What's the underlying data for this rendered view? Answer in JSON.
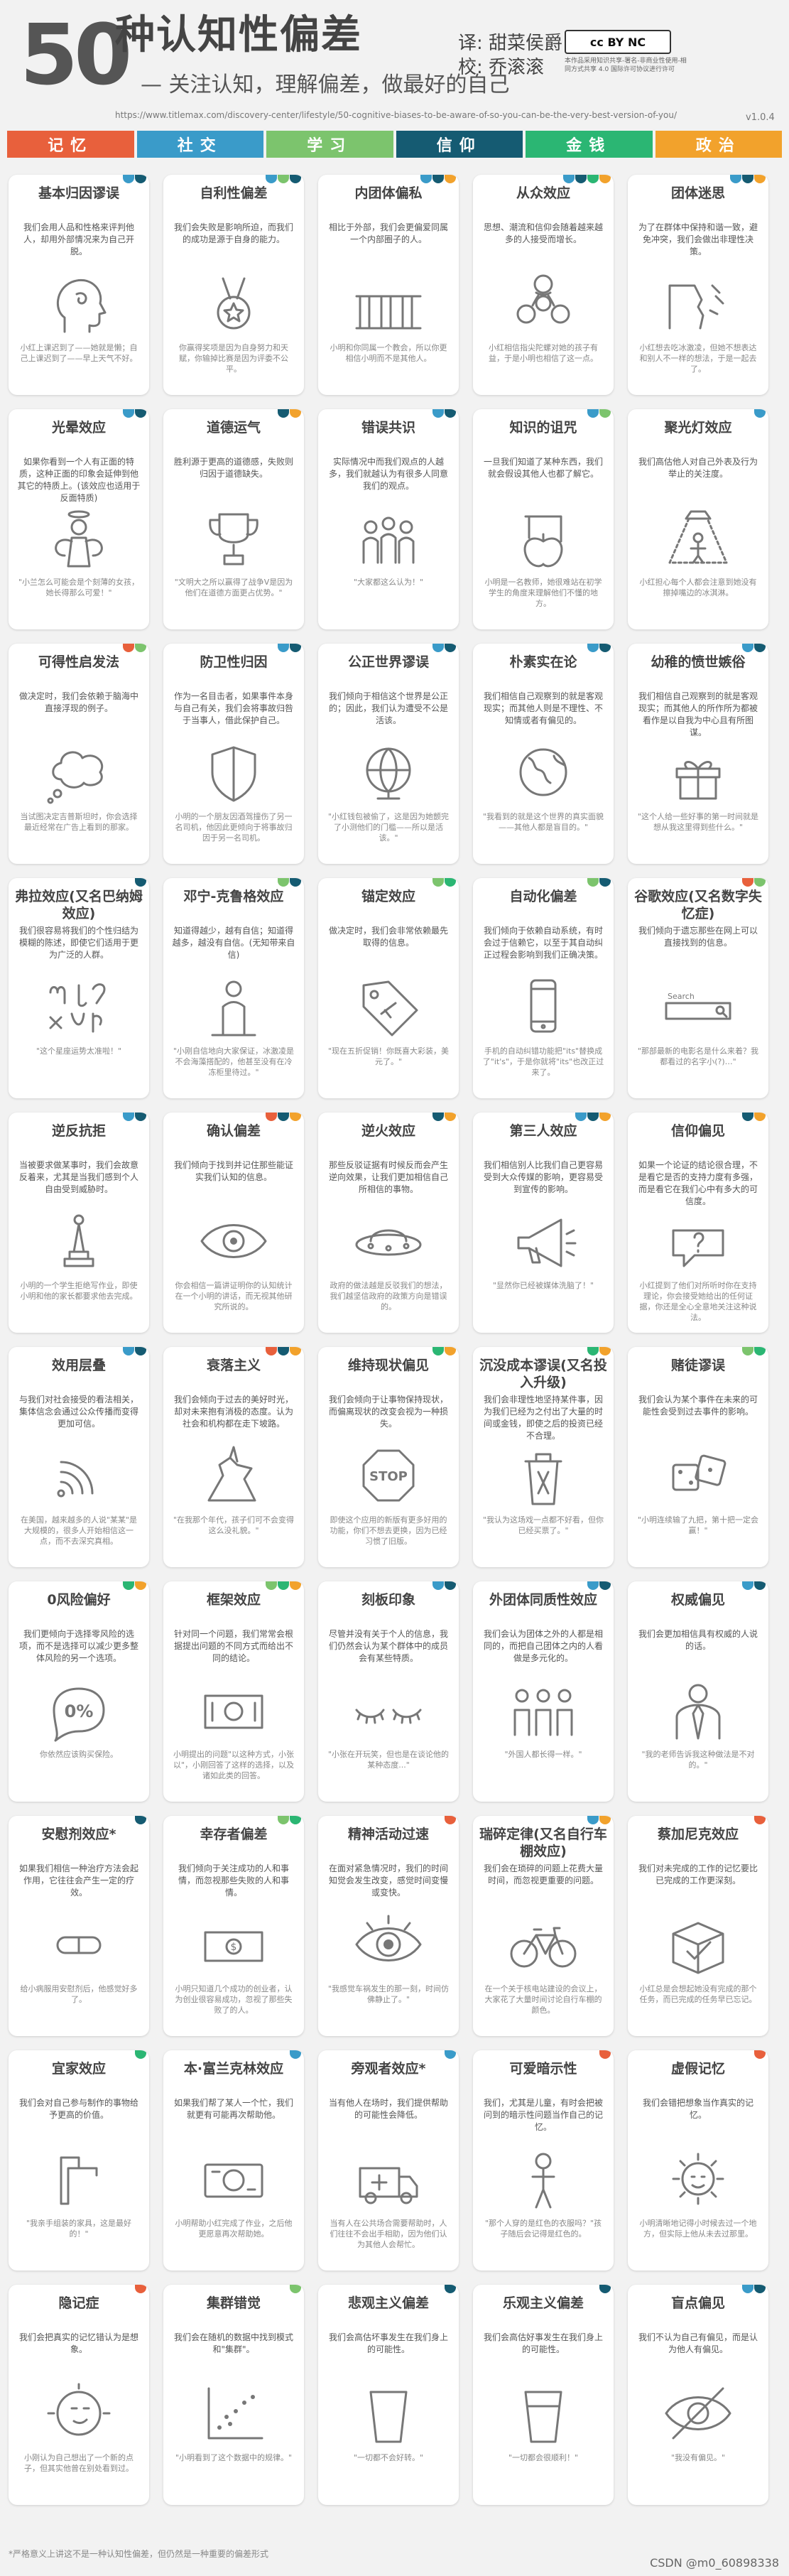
{
  "header": {
    "num": "50",
    "title": "种认知性偏差",
    "subtitle": "— 关注认知，理解偏差，做最好的自己",
    "url": "https://www.titlemax.com/discovery-center/lifestyle/50-cognitive-biases-to-be-aware-of-so-you-can-be-the-very-best-version-of-you/",
    "translator": "译: 甜菜侯爵",
    "proofreader": "校: 乔滚滚",
    "cc_logo": "cc BY NC",
    "cc_text": "本作品采用知识共享-署名-非商业性使用-相同方式共享 4.0 国际许可协议进行许可",
    "version": "v1.0.4"
  },
  "colors": {
    "memory": "#e8603c",
    "social": "#3a9bc9",
    "learning": "#7cc46d",
    "belief": "#155b72",
    "money": "#2bb673",
    "politics": "#f2a22c"
  },
  "categories": [
    {
      "label": "记忆",
      "key": "memory"
    },
    {
      "label": "社交",
      "key": "social"
    },
    {
      "label": "学习",
      "key": "learning"
    },
    {
      "label": "信仰",
      "key": "belief"
    },
    {
      "label": "金钱",
      "key": "money"
    },
    {
      "label": "政治",
      "key": "politics"
    }
  ],
  "cards": [
    {
      "title": "基本归因谬误",
      "desc": "我们会用人品和性格来评判他人，却用外部情况来为自己开脱。",
      "ex": "小红上课迟到了——她就是懒；自己上课迟到了——早上天气不好。",
      "icon": "head-icon",
      "dots": [
        "social",
        "belief"
      ]
    },
    {
      "title": "自利性偏差",
      "desc": "我们会失败是影响所迫，而我们的成功是源于自身的能力。",
      "ex": "你赢得奖项是因为自身努力和天赋，你输掉比赛是因为评委不公平。",
      "icon": "medal-icon",
      "dots": [
        "social",
        "learning",
        "belief"
      ]
    },
    {
      "title": "内团体偏私",
      "desc": "相比于外部，我们会更偏爱同属一个内部圈子的人。",
      "ex": "小明和你同属一个教会，所以你更相信小明而不是其他人。",
      "icon": "stonehenge-icon",
      "dots": [
        "social",
        "belief",
        "politics"
      ]
    },
    {
      "title": "从众效应",
      "desc": "思想、潮流和信仰会随着越来越多的人接受而增长。",
      "ex": "小红相信指尖陀螺对她的孩子有益，于是小明也相信了这一点。",
      "icon": "spinner-icon",
      "dots": [
        "social",
        "belief",
        "money",
        "politics"
      ]
    },
    {
      "title": "团体迷思",
      "desc": "为了在群体中保持和谐一致，避免冲突，我们会做出非理性决策。",
      "ex": "小红想去吃冰激凌，但她不想表达和别人不一样的想法，于是一起去了。",
      "icon": "cliff-icon",
      "dots": [
        "social",
        "belief",
        "politics"
      ]
    },
    {
      "title": "光晕效应",
      "desc": "如果你看到一个人有正面的特质，这种正面的印象会延伸到他其它的特质上。(该效应也适用于反面特质)",
      "ex": "\"小兰怎么可能会是个刻薄的女孩，她长得那么可爱！\"",
      "icon": "angel-icon",
      "dots": [
        "social",
        "belief"
      ]
    },
    {
      "title": "道德运气",
      "desc": "胜利源于更高的道德感，失败则归因于道德缺失。",
      "ex": "\"文明大之所以赢得了战争V是因为他们在道德方面更占优势。\"",
      "icon": "trophy-icon",
      "dots": [
        "belief",
        "politics"
      ]
    },
    {
      "title": "错误共识",
      "desc": "实际情况中而我们观点的人越多，我们就越认为有很多人同意我们的观点。",
      "ex": "\"大家都这么认为！\"",
      "icon": "crowd-icon",
      "dots": [
        "social",
        "belief"
      ]
    },
    {
      "title": "知识的诅咒",
      "desc": "一旦我们知道了某种东西，我们就会假设其他人也都了解它。",
      "ex": "小明是一名教师，她很难站在初学学生的角度来理解他们不懂的地方。",
      "icon": "apple-icon",
      "dots": [
        "social",
        "learning"
      ]
    },
    {
      "title": "聚光灯效应",
      "desc": "我们高估他人对自己外表及行为举止的关注度。",
      "ex": "小红担心每个人都会注意到她没有擦掉嘴边的冰淇淋。",
      "icon": "spotlight-icon",
      "dots": [
        "social"
      ]
    },
    {
      "title": "可得性启发法",
      "desc": "做决定时，我们会依赖于脑海中直接浮现的例子。",
      "ex": "当试图决定吉普斯坦时，你会选择最近经常在广告上看到的那家。",
      "icon": "thought-icon",
      "dots": [
        "memory",
        "learning"
      ]
    },
    {
      "title": "防卫性归因",
      "desc": "作为一名目击者，如果事件本身与自己有关，我们会将事故归咎于当事人，借此保护自己。",
      "ex": "小明的一个朋友因酒驾撞伤了另一名司机，他因此更倾向于将事故归因于另一名司机。",
      "icon": "shield-icon",
      "dots": [
        "social",
        "belief"
      ]
    },
    {
      "title": "公正世界谬误",
      "desc": "我们倾向于相信这个世界是公正的；因此，我们认为遭受不公是活该。",
      "ex": "\"小红钱包被偷了，这是因为她颤完了小测他们的门槛——所以是活该。\"",
      "icon": "globe-icon",
      "dots": [
        "social",
        "belief"
      ]
    },
    {
      "title": "朴素实在论",
      "desc": "我们相信自己观察到的就是客观现实；而其他人则是不理性、不知情或者有偏见的。",
      "ex": "\"我看到的就是这个世界的真实面貌——其他人都是盲目的。\"",
      "icon": "earth-icon",
      "dots": [
        "social",
        "belief"
      ]
    },
    {
      "title": "幼稚的愤世嫉俗",
      "desc": "我们相信自己观察到的就是客观现实；而其他人的所作所为都被看作是以自我为中心且有所图谋。",
      "ex": "\"这个人给一些好事的第一时间就是想从我这里得到些什么。\"",
      "icon": "gift-icon",
      "dots": [
        "social",
        "belief"
      ]
    },
    {
      "title": "弗拉效应(又名巴纳姆效应)",
      "desc": "我们很容易将我们的个性归结为模糊的陈述，即使它们适用于更为广泛的人群。",
      "ex": "\"这个星座运势太准啦！\"",
      "icon": "zodiac-icon",
      "dots": [
        "belief"
      ]
    },
    {
      "title": "邓宁-克鲁格效应",
      "desc": "知道得越少，越有自信；知道得越多，越没有自信。(无知带来自信)",
      "ex": "\"小刚自信地向大家保证，冰激凌是不会海藻搭配的，他甚至没有在冷冻柜里待过。\"",
      "icon": "person-icon",
      "dots": [
        "learning",
        "belief"
      ]
    },
    {
      "title": "锚定效应",
      "desc": "做决定时，我们会非常依赖最先取得的信息。",
      "ex": "\"现在五折促销！你既喜大彩装，美元了。\"",
      "icon": "tag-icon",
      "dots": [
        "learning",
        "money"
      ]
    },
    {
      "title": "自动化偏差",
      "desc": "我们倾向于依赖自动系统，有时会过于信赖它，以至于其自动纠正过程会影响到我们正确决策。",
      "ex": "手机的自动纠错功能把\"its\"替换成了\"it's\"，于是你就将\"its\"也改正过来了。",
      "icon": "phone-icon",
      "dots": [
        "learning",
        "belief"
      ]
    },
    {
      "title": "谷歌效应(又名数字失忆症)",
      "desc": "我们倾向于遗忘那些在网上可以直接找到的信息。",
      "ex": "\"那部最新的电影名是什么来着？我都看过的名字小(?)…\"",
      "icon": "search-box-icon",
      "dots": [
        "memory",
        "learning"
      ],
      "search_label": "Search"
    },
    {
      "title": "逆反抗拒",
      "desc": "当被要求做某事时，我们会故意反着来，尤其是当我们感到个人自由受到威胁时。",
      "ex": "小明的一个学生拒绝写作业，即使小明和他的家长都要求他去完成。",
      "icon": "pawn-icon",
      "dots": [
        "social",
        "belief"
      ]
    },
    {
      "title": "确认偏差",
      "desc": "我们倾向于找到并记住那些能证实我们认知的信息。",
      "ex": "你会相信一篇讲证明你的认知统计在一个小明的讲话，而无视其他研究所说的。",
      "icon": "eye-icon",
      "dots": [
        "memory",
        "belief",
        "politics"
      ]
    },
    {
      "title": "逆火效应",
      "desc": "那些反驳证据有时候反而会产生逆向效果，让我们更加相信自己所相信的事物。",
      "ex": "政府的做法越是反驳我们的想法，我们越坚信政府的政策方向是错误的。",
      "icon": "ufo-icon",
      "dots": [
        "belief",
        "politics"
      ]
    },
    {
      "title": "第三人效应",
      "desc": "我们相信别人比我们自己更容易受到大众传媒的影响，更容易受到宣传的影响。",
      "ex": "\"显然你已经被媒体洗脑了！\"",
      "icon": "megaphone-icon",
      "dots": [
        "social",
        "belief",
        "politics"
      ]
    },
    {
      "title": "信仰偏见",
      "desc": "如果一个论证的结论很合理，不是看它是否的支持力度有多强，而是看它在我们心中有多大的可信度。",
      "ex": "小红提到了他们对所听时你在支持理论，你会接受她给出的任何证据，你还是全心全意地关注这种说法。",
      "icon": "think-bubble-icon",
      "dots": [
        "belief",
        "politics"
      ]
    },
    {
      "title": "效用层叠",
      "desc": "与我们对社会接受的看法相关，集体信念会通过公众传播而变得更加可信。",
      "ex": "在美国，越来越多的人说\"某某\"是大规模的，很多人开始相信这一点，而不去深究真相。",
      "icon": "signal-icon",
      "dots": [
        "social",
        "belief"
      ]
    },
    {
      "title": "衰落主义",
      "desc": "我们会倾向于过去的美好时光，却对未来抱有消极的态度。认为社会和机构都在走下坡路。",
      "ex": "\"在我那个年代，孩子们可不会变得这么没礼貌。\"",
      "icon": "knight-icon",
      "dots": [
        "memory",
        "belief",
        "politics"
      ]
    },
    {
      "title": "维持现状偏见",
      "desc": "我们会倾向于让事物保持现状，而偏离现状的改变会视为一种损失。",
      "ex": "即使这个应用的新版有更多好用的功能，你们不想去更换，因为已经习惯了旧版。",
      "icon": "stop-icon",
      "dots": [
        "money",
        "politics"
      ]
    },
    {
      "title": "沉没成本谬误(又名投入升级)",
      "desc": "我们会非理性地坚持某件事，因为我们已经为之付出了大量的时间或金钱，即使之后的投资已经不合理。",
      "ex": "\"我认为这场戏一点都不好看，但你已经买票了。\"",
      "icon": "trash-icon",
      "dots": [
        "money",
        "politics"
      ]
    },
    {
      "title": "赌徒谬误",
      "desc": "我们会认为某个事件在未来的可能性会受到过去事件的影响。",
      "ex": "\"小明连续输了九把，第十把一定会赢！\"",
      "icon": "dice-icon",
      "dots": [
        "learning",
        "money"
      ]
    },
    {
      "title": "0风险偏好",
      "desc": "我们更倾向于选择零风险的选项，而不是选择可以减少更多整体风险的另一个选项。",
      "ex": "你依然应该购买保险。",
      "icon": "percent-icon",
      "dots": [
        "money",
        "politics"
      ]
    },
    {
      "title": "框架效应",
      "desc": "针对同一个问题，我们常常会根据提出问题的不同方式而给出不同的结论。",
      "ex": "小明提出的问题\"以这种方式，小张以\"，小刚回答了这样的选择，以及诸如此类的回答。",
      "icon": "bill-icon",
      "dots": [
        "learning",
        "money",
        "politics"
      ]
    },
    {
      "title": "刻板印象",
      "desc": "尽管并没有关于个人的信息，我们仍然会认为某个群体中的成员会有某些特质。",
      "ex": "\"小张在开玩笑，但也是在谈论他的某种态度...\"",
      "icon": "closed-eyes-icon",
      "dots": [
        "social",
        "belief"
      ]
    },
    {
      "title": "外团体同质性效应",
      "desc": "我们会认为团体之外的人都是相同的，而把自己团体之内的人看做是多元化的。",
      "ex": "\"外国人都长得一样。\"",
      "icon": "group-icon",
      "dots": [
        "social",
        "belief"
      ]
    },
    {
      "title": "权威偏见",
      "desc": "我们会更加相信具有权威的人说的话。",
      "ex": "\"我的老师告诉我这种做法是不对的。\"",
      "icon": "suit-icon",
      "dots": [
        "social",
        "belief"
      ]
    },
    {
      "title": "安慰剂效应*",
      "desc": "如果我们相信一种治疗方法会起作用，它往往会产生一定的疗效。",
      "ex": "给小病服用安慰剂后，他感觉好多了。",
      "icon": "pill-icon",
      "dots": [
        "belief"
      ]
    },
    {
      "title": "幸存者偏差",
      "desc": "我们倾向于关注成功的人和事情，而忽视那些失败的人和事情。",
      "ex": "小明只知道几个成功的创业者，认为创业很容易成功，忽视了那些失败了的人。",
      "icon": "money-icon",
      "dots": [
        "learning",
        "money"
      ]
    },
    {
      "title": "精神活动过速",
      "desc": "在面对紧急情况时，我们的时间知觉会发生改变，感觉时间变慢或变快。",
      "ex": "\"我感觉车祸发生的那一刻，时间仿佛静止了。\"",
      "icon": "eye-open-icon",
      "dots": [
        "memory"
      ]
    },
    {
      "title": "瑞碎定律(又名自行车棚效应)",
      "desc": "我们会在琐碎的问题上花费大量时间，而忽视更重要的问题。",
      "ex": "在一个关于核电站建设的会议上，大家花了大量时间讨论自行车棚的颜色。",
      "icon": "bicycle-icon",
      "dots": [
        "social",
        "politics"
      ]
    },
    {
      "title": "蔡加尼克效应",
      "desc": "我们对未完成的工作的记忆要比已完成的工作更深刻。",
      "ex": "小红总是会想起她没有完成的那个任务，而已完成的任务早已忘记。",
      "icon": "checkbox-icon",
      "dots": [
        "memory"
      ]
    },
    {
      "title": "宜家效应",
      "desc": "我们会对自己参与制作的事物给予更高的价值。",
      "ex": "\"我亲手组装的家具，这是最好的！\"",
      "icon": "wrench-icon",
      "dots": [
        "money"
      ]
    },
    {
      "title": "本·富兰克林效应",
      "desc": "如果我们帮了某人一个忙，我们就更有可能再次帮助他。",
      "ex": "小明帮助小红完成了作业，之后他更愿意再次帮助她。",
      "icon": "dollar-icon",
      "dots": [
        "social"
      ]
    },
    {
      "title": "旁观者效应*",
      "desc": "当有他人在场时，我们提供帮助的可能性会降低。",
      "ex": "当有人在公共场合需要帮助时，人们往往不会出手相助，因为他们认为其他人会帮忙。",
      "icon": "ambulance-icon",
      "dots": [
        "social"
      ]
    },
    {
      "title": "可爱暗示性",
      "desc": "我们，尤其是儿童，有时会把被问到的暗示性问题当作自己的记忆。",
      "ex": "\"那个人穿的是红色的衣服吗？\"孩子随后会记得是红色的。",
      "icon": "child-icon",
      "dots": [
        "memory"
      ]
    },
    {
      "title": "虚假记忆",
      "desc": "我们会错把想象当作真实的记忆。",
      "ex": "小明清晰地记得小时候去过一个地方，但实际上他从未去过那里。",
      "icon": "sun-face-icon",
      "dots": [
        "memory"
      ]
    },
    {
      "title": "隐记症",
      "desc": "我们会把真实的记忆错认为是想象。",
      "ex": "小刚认为自己想出了一个新的点子，但其实他曾在别处看到过。",
      "icon": "moon-icon",
      "dots": [
        "memory"
      ]
    },
    {
      "title": "集群错觉",
      "desc": "我们会在随机的数据中找到模式和\"集群\"。",
      "ex": "\"小明看到了这个数据中的规律。\"",
      "icon": "scatter-icon",
      "dots": [
        "learning"
      ]
    },
    {
      "title": "悲观主义偏差",
      "desc": "我们会高估坏事发生在我们身上的可能性。",
      "ex": "\"一切都不会好转。\"",
      "icon": "glass-empty-icon",
      "dots": [
        "belief"
      ]
    },
    {
      "title": "乐观主义偏差",
      "desc": "我们会高估好事发生在我们身上的可能性。",
      "ex": "\"一切都会很顺利！\"",
      "icon": "glass-full-icon",
      "dots": [
        "belief"
      ]
    },
    {
      "title": "盲点偏见",
      "desc": "我们不认为自己有偏见，而是认为他人有偏见。",
      "ex": "\"我没有偏见。\"",
      "icon": "blind-eye-icon",
      "dots": [
        "social",
        "belief"
      ]
    }
  ],
  "footer": {
    "note": "*严格意义上讲这不是一种认知性偏差，但仍然是一种重要的偏差形式",
    "watermark": "CSDN @m0_60898338"
  }
}
